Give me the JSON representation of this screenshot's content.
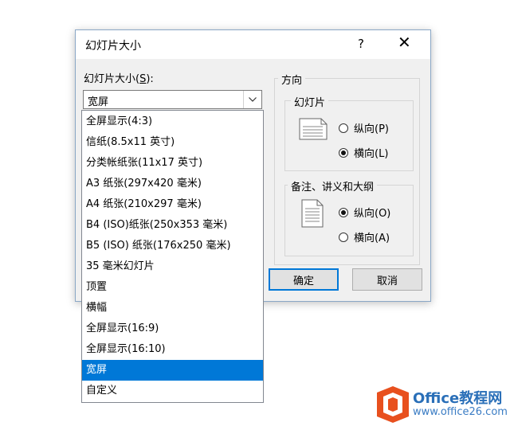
{
  "dialog": {
    "title": "幻灯片大小",
    "help": "?",
    "close": "✕",
    "size_label_pre": "幻灯片大小(",
    "size_label_key": "S",
    "size_label_post": "):",
    "size_value": "宽屏",
    "orientation": {
      "title": "方向",
      "slides": {
        "title": "幻灯片",
        "portrait_label": "纵向(P)",
        "landscape_label": "横向(L)",
        "selected": "landscape"
      },
      "notes": {
        "title": "备注、讲义和大纲",
        "portrait_label": "纵向(O)",
        "landscape_label": "横向(A)",
        "selected": "portrait"
      }
    },
    "ok_label": "确定",
    "cancel_label": "取消"
  },
  "dropdown": {
    "items": [
      "全屏显示(4:3)",
      "信纸(8.5x11 英寸)",
      "分类帐纸张(11x17 英寸)",
      "A3 纸张(297x420 毫米)",
      "A4 纸张(210x297 毫米)",
      "B4 (ISO)纸张(250x353 毫米)",
      "B5 (ISO) 纸张(176x250 毫米)",
      "35 毫米幻灯片",
      "顶置",
      "横幅",
      "全屏显示(16:9)",
      "全屏显示(16:10)",
      "宽屏",
      "自定义"
    ],
    "selected_index": 12
  },
  "watermark": {
    "name": "Office教程网",
    "url": "www.office26.com",
    "colors": {
      "orange": "#e8501e",
      "blue": "#2a6fb8"
    }
  }
}
